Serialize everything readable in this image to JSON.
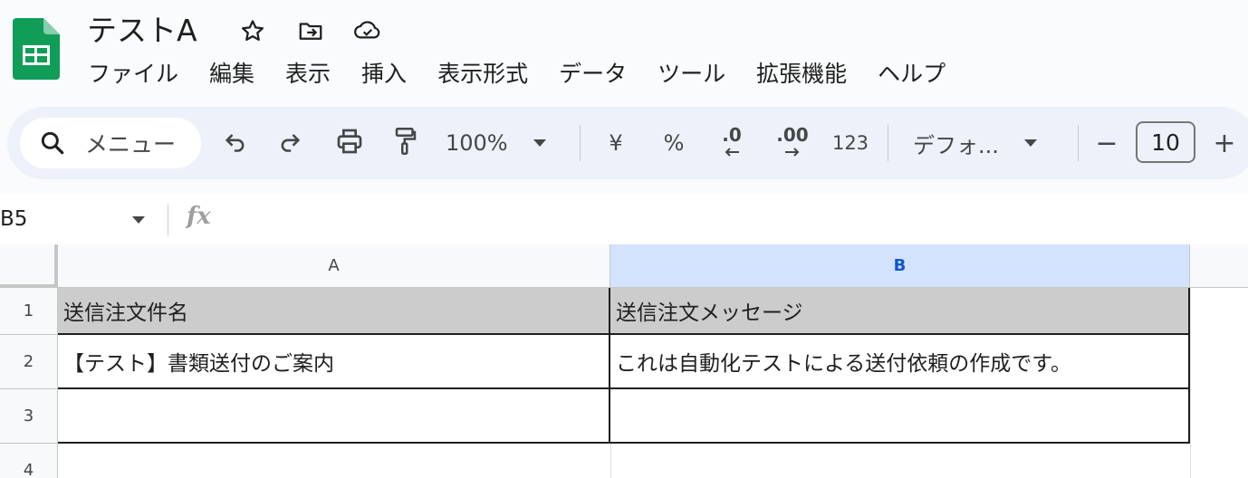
{
  "app": {
    "doc_title": "テストA",
    "brand_color": "#0f9d58",
    "title_icons": [
      "star-icon",
      "move-folder-icon",
      "cloud-saved-icon"
    ]
  },
  "menu": [
    "ファイル",
    "編集",
    "表示",
    "挿入",
    "表示形式",
    "データ",
    "ツール",
    "拡張機能",
    "ヘルプ"
  ],
  "toolbar": {
    "search_label": "メニュー",
    "zoom": "100%",
    "currency": "¥",
    "percent": "%",
    "decrease_decimal": ".0",
    "increase_decimal": ".00",
    "number_format": "123",
    "font": "デフォ...",
    "font_size": "10",
    "minus": "−",
    "plus": "+"
  },
  "formula_bar": {
    "name_box": "B5",
    "fx": "fx",
    "value": ""
  },
  "sheet": {
    "columns": [
      "A",
      "B"
    ],
    "selected_column": "B",
    "rows": [
      "1",
      "2",
      "3",
      "4"
    ],
    "cells": {
      "A1": "送信注文件名",
      "B1": "送信注文メッセージ",
      "A2": "【テスト】書類送付のご案内",
      "B2": "これは自動化テストによる送付依頼の作成です。",
      "A3": "",
      "B3": ""
    },
    "header_fill_color": "#cccccc",
    "selection_color": "#d3e3fd"
  }
}
